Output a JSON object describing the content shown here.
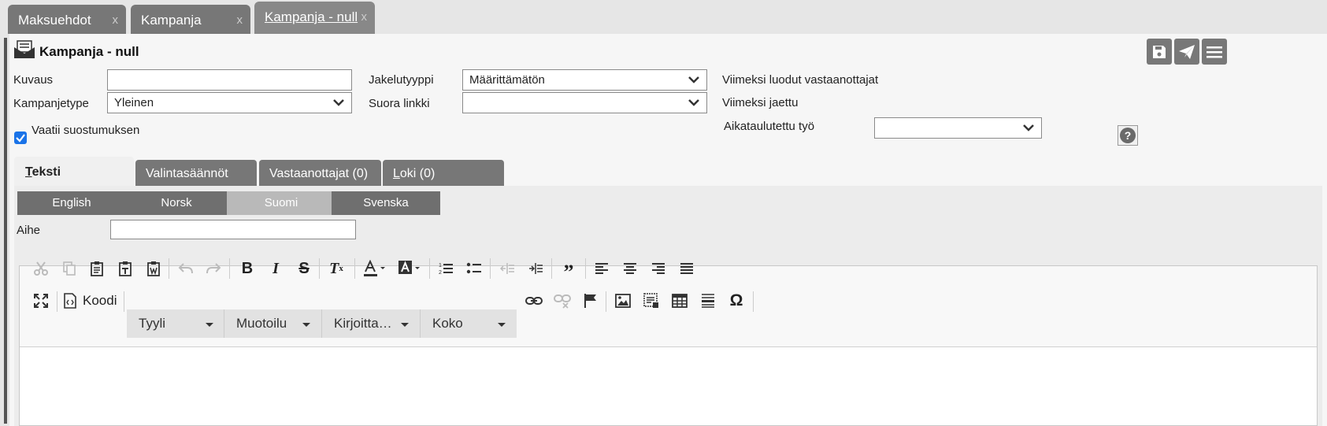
{
  "window_tabs": [
    {
      "label": "Maksuehdot",
      "close": "x"
    },
    {
      "label": "Kampanja",
      "close": "x"
    },
    {
      "label": "Kampanja - null",
      "close": "x"
    }
  ],
  "header": {
    "title": "Kampanja - null"
  },
  "form": {
    "kuvaus_label": "Kuvaus",
    "kuvaus_value": "",
    "kampanjetype_label": "Kampanjetype",
    "kampanjetype_value": "Yleinen",
    "vaatii_label": "Vaatii suostumuksen",
    "jakelutyyppi_label": "Jakelutyyppi",
    "jakelutyyppi_value": "Määrittämätön",
    "suora_linkki_label": "Suora linkki",
    "suora_linkki_value": "",
    "viimeksi_luodut_label": "Viimeksi luodut vastaanottajat",
    "viimeksi_jaettu_label": "Viimeksi jaettu",
    "aikataulutettu_label": "Aikataulutettu työ",
    "aikataulutettu_value": "",
    "help": "?"
  },
  "content_tabs": [
    {
      "first": "T",
      "rest": "eksti"
    },
    {
      "first": "",
      "rest": "Valintasäännöt"
    },
    {
      "first": "",
      "rest": "Vastaanottajat (0)"
    },
    {
      "first": "L",
      "rest": "oki (0)"
    }
  ],
  "languages": [
    "English",
    "Norsk",
    "Suomi",
    "Svenska"
  ],
  "aihe_label": "Aihe",
  "aihe_value": "",
  "editor": {
    "source_label": "Koodi",
    "combos": [
      "Tyyli",
      "Muotoilu",
      "Kirjoitta…",
      "Koko"
    ]
  },
  "colors": {
    "tab_bg": "#777777",
    "accent": "#1a73e8"
  }
}
